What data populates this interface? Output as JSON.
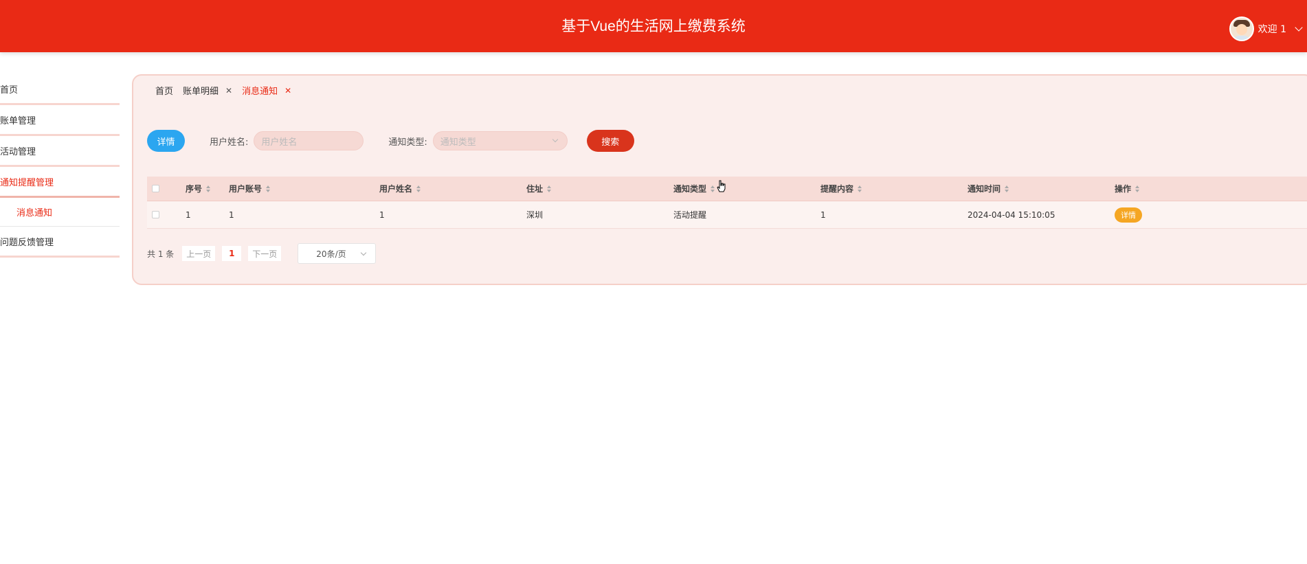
{
  "header": {
    "title": "基于Vue的生活网上缴费系统",
    "welcome": "欢迎 1",
    "colors": {
      "brand": "#e92a15"
    }
  },
  "sidebar": {
    "items": [
      {
        "label": "首页"
      },
      {
        "label": "账单管理"
      },
      {
        "label": "活动管理"
      },
      {
        "label": "通知提醒管理",
        "active": true
      },
      {
        "label": "问题反馈管理"
      }
    ],
    "sub_item": "消息通知"
  },
  "tabs": [
    {
      "label": "首页"
    },
    {
      "label": "账单明细",
      "close": "✕"
    },
    {
      "label": "消息通知",
      "close": "✕",
      "active": true
    }
  ],
  "toolbar": {
    "detail_button": "详情",
    "user_name_label": "用户姓名:",
    "user_name_placeholder": "用户姓名",
    "notify_type_label": "通知类型:",
    "notify_type_placeholder": "通知类型",
    "search_button": "搜索"
  },
  "table": {
    "columns": [
      "序号",
      "用户账号",
      "用户姓名",
      "住址",
      "通知类型",
      "提醒内容",
      "通知时间",
      "操作"
    ],
    "rows": [
      {
        "index": "1",
        "account": "1",
        "name": "1",
        "address": "深圳",
        "type": "活动提醒",
        "content": "1",
        "time": "2024-04-04 15:10:05",
        "action": "详情"
      }
    ]
  },
  "pagination": {
    "total": "共 1 条",
    "prev": "上一页",
    "current": "1",
    "next": "下一页",
    "page_size": "20条/页"
  }
}
